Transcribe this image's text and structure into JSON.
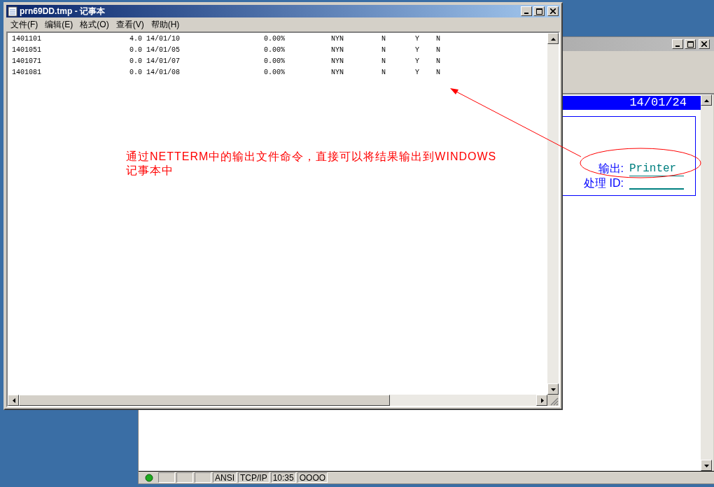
{
  "terminal": {
    "date": "14/01/24",
    "output_label": "输出:",
    "output_value": "Printer",
    "batch_label": "处理 ID:",
    "status_bar": [
      "ANSI",
      "TCP/IP",
      "10:35",
      "OOOO"
    ]
  },
  "notepad": {
    "title": "prn69DD.tmp - 记事本",
    "menu": [
      "文件(F)",
      "编辑(E)",
      "格式(O)",
      "查看(V)",
      "帮助(H)"
    ],
    "lines": [
      "1401101                     4.0 14/01/10                    0.00%           NYN         N       Y    N",
      "1401051                     0.0 14/01/05                    0.00%           NYN         N       Y    N",
      "1401071                     0.0 14/01/07                    0.00%           NYN         N       Y    N",
      "1401081                     0.0 14/01/08                    0.00%           NYN         N       Y    N"
    ]
  },
  "annotation": {
    "text": "通过NETTERM中的输出文件命令，直接可以将结果输出到WINDOWS记事本中"
  }
}
